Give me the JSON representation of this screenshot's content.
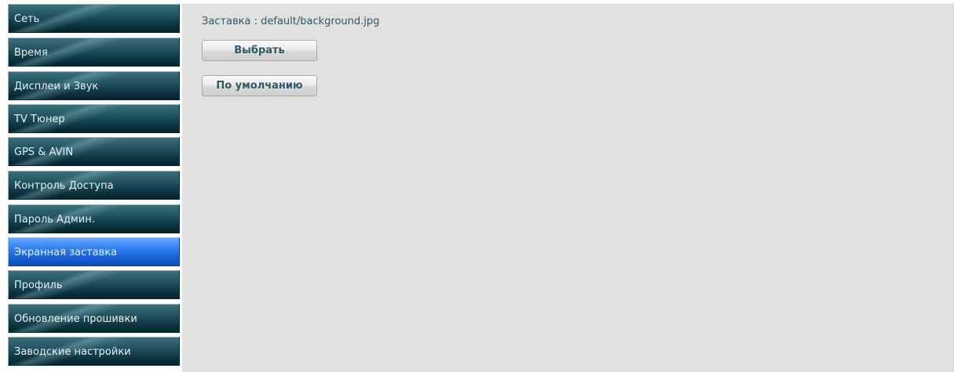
{
  "sidebar": {
    "items": [
      {
        "label": "Сеть"
      },
      {
        "label": "Время"
      },
      {
        "label": "Дисплеи и Звук"
      },
      {
        "label": "TV Тюнер"
      },
      {
        "label": "GPS & AVIN"
      },
      {
        "label": "Контроль Доступа"
      },
      {
        "label": "Пароль Админ."
      },
      {
        "label": "Экранная заставка"
      },
      {
        "label": "Профиль"
      },
      {
        "label": "Обновление прошивки"
      },
      {
        "label": "Заводские настройки"
      }
    ],
    "active_index": 7
  },
  "main": {
    "screensaver_line": "Заставка : default/background.jpg",
    "choose_button": "Выбрать",
    "default_button": "По умолчанию"
  },
  "colors": {
    "nav_dark": "#0b3440",
    "nav_active": "#2f7df2",
    "content_bg": "#e1e1e1",
    "text_teal": "#2f5968"
  }
}
